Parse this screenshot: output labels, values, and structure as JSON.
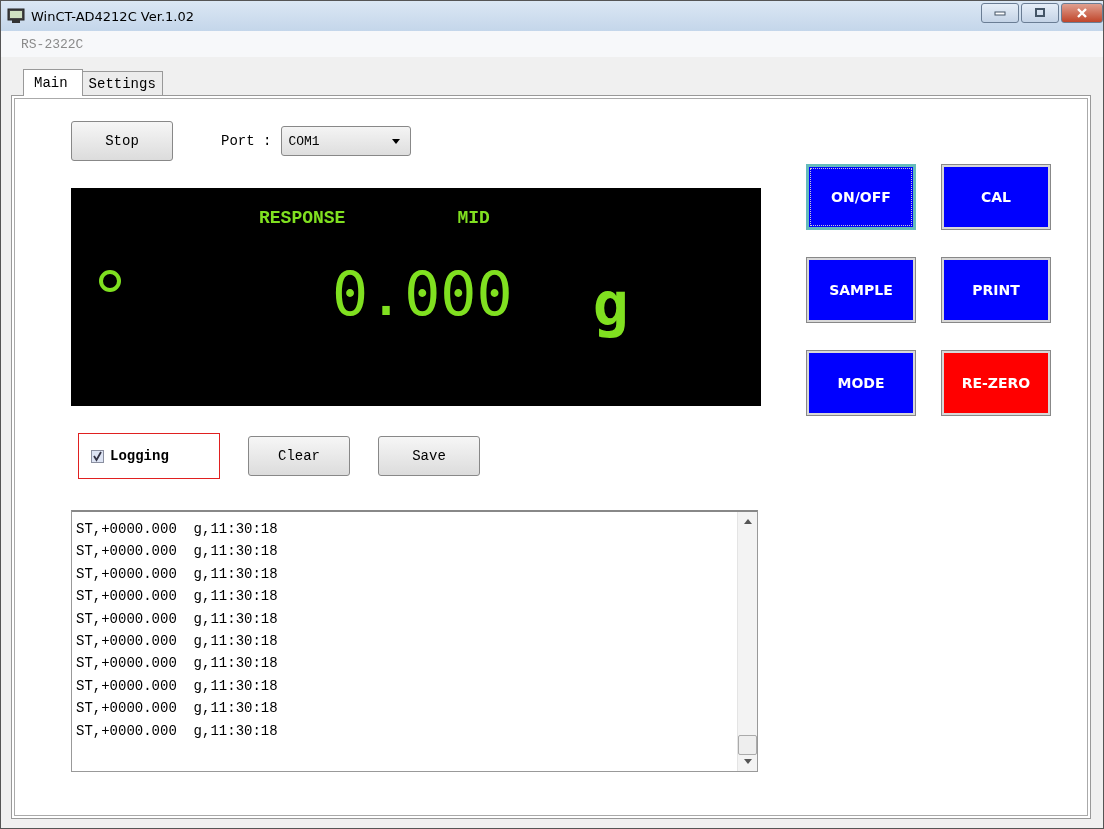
{
  "window": {
    "title": "WinCT-AD4212C Ver.1.02"
  },
  "menu": {
    "label": "RS-2322C",
    "disabled": true
  },
  "tabs": [
    {
      "label": "Main",
      "selected": true
    },
    {
      "label": "Settings",
      "selected": false
    }
  ],
  "controls": {
    "stop_button": "Stop",
    "port_label": "Port :",
    "port_value": "COM1"
  },
  "display": {
    "response_label": "RESPONSE",
    "mode_label": "MID",
    "stable": true,
    "value": "0.000",
    "unit": "g"
  },
  "key_buttons": [
    {
      "label": "ON/OFF",
      "color": "#0000ff",
      "focused": true
    },
    {
      "label": "CAL",
      "color": "#0000ff",
      "focused": false
    },
    {
      "label": "SAMPLE",
      "color": "#0000ff",
      "focused": false
    },
    {
      "label": "PRINT",
      "color": "#0000ff",
      "focused": false
    },
    {
      "label": "MODE",
      "color": "#0000ff",
      "focused": false
    },
    {
      "label": "RE-ZERO",
      "color": "#ff0000",
      "focused": false
    }
  ],
  "logging": {
    "label": "Logging",
    "checked": true,
    "highlighted": true
  },
  "log_buttons": [
    "Clear",
    "Save"
  ],
  "log_lines": [
    "ST,+0000.000  g,11:30:18",
    "ST,+0000.000  g,11:30:18",
    "ST,+0000.000  g,11:30:18",
    "ST,+0000.000  g,11:30:18",
    "ST,+0000.000  g,11:30:18",
    "ST,+0000.000  g,11:30:18",
    "ST,+0000.000  g,11:30:18",
    "ST,+0000.000  g,11:30:18",
    "ST,+0000.000  g,11:30:18",
    "ST,+0000.000  g,11:30:18"
  ]
}
